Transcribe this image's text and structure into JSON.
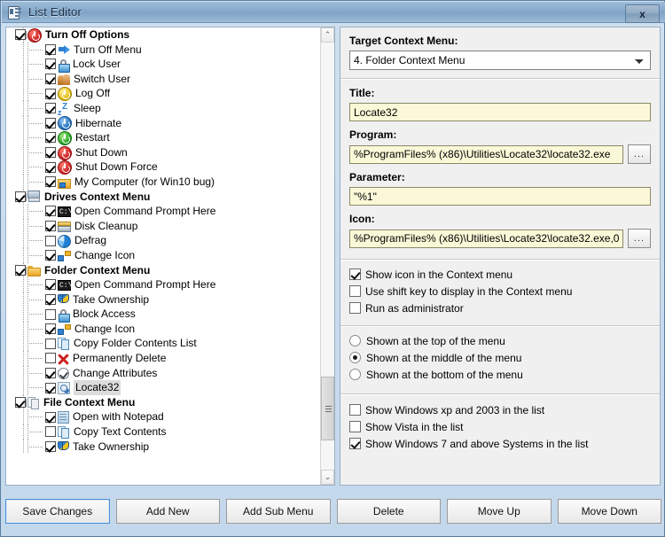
{
  "window": {
    "title": "List Editor",
    "icon": "list-editor-icon",
    "close_label": "x"
  },
  "tree": {
    "items": [
      {
        "label": "Turn Off Options",
        "level": 0,
        "checked": true,
        "bold": true,
        "icon": "power-red-icon",
        "expander": true,
        "selected": false
      },
      {
        "label": "Turn Off Menu",
        "level": 1,
        "checked": true,
        "bold": false,
        "icon": "blue-arrow-icon",
        "expander": false,
        "selected": false
      },
      {
        "label": "Lock User",
        "level": 1,
        "checked": true,
        "bold": false,
        "icon": "padlock-icon",
        "expander": false,
        "selected": false
      },
      {
        "label": "Switch User",
        "level": 1,
        "checked": true,
        "bold": false,
        "icon": "users-icon",
        "expander": false,
        "selected": false
      },
      {
        "label": "Log Off",
        "level": 1,
        "checked": true,
        "bold": false,
        "icon": "power-yellow-icon",
        "expander": false,
        "selected": false
      },
      {
        "label": "Sleep",
        "level": 1,
        "checked": true,
        "bold": false,
        "icon": "sleep-zz-icon",
        "expander": false,
        "selected": false
      },
      {
        "label": "Hibernate",
        "level": 1,
        "checked": true,
        "bold": false,
        "icon": "power-blue-icon",
        "expander": false,
        "selected": false
      },
      {
        "label": "Restart",
        "level": 1,
        "checked": true,
        "bold": false,
        "icon": "power-green-icon",
        "expander": false,
        "selected": false
      },
      {
        "label": "Shut Down",
        "level": 1,
        "checked": true,
        "bold": false,
        "icon": "power-red-icon",
        "expander": false,
        "selected": false
      },
      {
        "label": "Shut Down Force",
        "level": 1,
        "checked": true,
        "bold": false,
        "icon": "power-red-icon",
        "expander": false,
        "selected": false
      },
      {
        "label": "My Computer (for Win10 bug)",
        "level": 1,
        "checked": true,
        "bold": false,
        "icon": "my-computer-icon",
        "expander": false,
        "selected": false
      },
      {
        "label": "Drives Context Menu",
        "level": 0,
        "checked": true,
        "bold": true,
        "icon": "drive-icon",
        "expander": true,
        "selected": false
      },
      {
        "label": "Open Command Prompt Here",
        "level": 1,
        "checked": true,
        "bold": false,
        "icon": "command-prompt-icon",
        "expander": false,
        "selected": false
      },
      {
        "label": "Disk Cleanup",
        "level": 1,
        "checked": true,
        "bold": false,
        "icon": "disk-cleanup-icon",
        "expander": false,
        "selected": false
      },
      {
        "label": "Defrag",
        "level": 1,
        "checked": false,
        "bold": false,
        "icon": "defrag-pie-icon",
        "expander": false,
        "selected": false
      },
      {
        "label": "Change Icon",
        "level": 1,
        "checked": true,
        "bold": false,
        "icon": "change-icon-icon",
        "expander": false,
        "selected": false
      },
      {
        "label": "Folder Context Menu",
        "level": 0,
        "checked": true,
        "bold": true,
        "icon": "folder-icon",
        "expander": true,
        "selected": false
      },
      {
        "label": "Open Command Prompt Here",
        "level": 1,
        "checked": true,
        "bold": false,
        "icon": "command-prompt-icon",
        "expander": false,
        "selected": false
      },
      {
        "label": "Take Ownership",
        "level": 1,
        "checked": true,
        "bold": false,
        "icon": "shield-icon",
        "expander": false,
        "selected": false
      },
      {
        "label": "Block Access",
        "level": 1,
        "checked": false,
        "bold": false,
        "icon": "padlock-icon",
        "expander": false,
        "selected": false
      },
      {
        "label": "Change Icon",
        "level": 1,
        "checked": true,
        "bold": false,
        "icon": "change-icon-icon",
        "expander": false,
        "selected": false
      },
      {
        "label": "Copy Folder Contents List",
        "level": 1,
        "checked": false,
        "bold": false,
        "icon": "copy-document-icon",
        "expander": false,
        "selected": false
      },
      {
        "label": "Permanently Delete",
        "level": 1,
        "checked": false,
        "bold": false,
        "icon": "red-x-icon",
        "expander": false,
        "selected": false
      },
      {
        "label": "Change Attributes",
        "level": 1,
        "checked": true,
        "bold": false,
        "icon": "attributes-icon",
        "expander": false,
        "selected": false
      },
      {
        "label": "Locate32",
        "level": 1,
        "checked": true,
        "bold": false,
        "icon": "search-icon",
        "expander": false,
        "selected": true
      },
      {
        "label": "File Context Menu",
        "level": 0,
        "checked": true,
        "bold": true,
        "icon": "files-icon",
        "expander": true,
        "selected": false
      },
      {
        "label": "Open with Notepad",
        "level": 1,
        "checked": true,
        "bold": false,
        "icon": "notepad-icon",
        "expander": false,
        "selected": false
      },
      {
        "label": "Copy Text Contents",
        "level": 1,
        "checked": false,
        "bold": false,
        "icon": "copy-document-icon",
        "expander": false,
        "selected": false
      },
      {
        "label": "Take Ownership",
        "level": 1,
        "checked": true,
        "bold": false,
        "icon": "shield-icon",
        "expander": false,
        "selected": false
      }
    ],
    "scrollbar": {
      "up_glyph": "⌃",
      "down_glyph": "⌄"
    }
  },
  "details": {
    "target_label": "Target Context Menu:",
    "target_value": "4. Folder Context Menu",
    "target_options": [
      "4. Folder Context Menu"
    ],
    "title_label": "Title:",
    "title_value": "Locate32",
    "program_label": "Program:",
    "program_value": "%ProgramFiles% (x86)\\Utilities\\Locate32\\locate32.exe",
    "parameter_label": "Parameter:",
    "parameter_value": "\"%1\"",
    "icon_label": "Icon:",
    "icon_value": "%ProgramFiles% (x86)\\Utilities\\Locate32\\locate32.exe,0",
    "browse_label": "...",
    "checkboxes": [
      {
        "label": "Show icon in the Context menu",
        "checked": true
      },
      {
        "label": "Use shift key to display in the Context menu",
        "checked": false
      },
      {
        "label": "Run as administrator",
        "checked": false
      }
    ],
    "position_options": [
      {
        "label": "Shown at the top of the menu",
        "selected": false
      },
      {
        "label": "Shown at the middle of the menu",
        "selected": true
      },
      {
        "label": "Shown at the bottom of the menu",
        "selected": false
      }
    ],
    "system_filters": [
      {
        "label": "Show Windows xp  and 2003 in the list",
        "checked": false
      },
      {
        "label": "Show Vista in the list",
        "checked": false
      },
      {
        "label": "Show Windows 7 and above Systems in the list",
        "checked": true
      }
    ]
  },
  "buttons": [
    {
      "label": "Save Changes",
      "default": true
    },
    {
      "label": "Add New",
      "default": false
    },
    {
      "label": "Add Sub Menu",
      "default": false
    },
    {
      "label": "Delete",
      "default": false
    },
    {
      "label": "Move Up",
      "default": false
    },
    {
      "label": "Move Down",
      "default": false
    }
  ]
}
